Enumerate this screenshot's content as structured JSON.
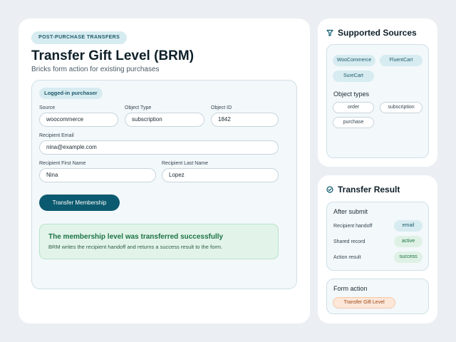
{
  "main": {
    "eyebrow": "POST-PURCHASE TRANSFERS",
    "title": "Transfer Gift Level (BRM)",
    "subtitle": "Bricks form action for existing purchases",
    "form": {
      "badge": "Logged-in purchaser",
      "fields": {
        "source": {
          "label": "Source",
          "value": "woocommerce"
        },
        "object_type": {
          "label": "Object Type",
          "value": "subscription"
        },
        "object_id": {
          "label": "Object ID",
          "value": "1842"
        },
        "recipient_email": {
          "label": "Recipient Email",
          "value": "nina@example.com"
        },
        "first_name": {
          "label": "Recipient First Name",
          "value": "Nina"
        },
        "last_name": {
          "label": "Recipient Last Name",
          "value": "Lopez"
        }
      },
      "submit_label": "Transfer Membership",
      "success": {
        "title": "The membership level was transferred successfully",
        "description": "BRM writes the recipient handoff and returns a success result to the form."
      }
    }
  },
  "supported_sources": {
    "title": "Supported Sources",
    "icon": "funnel-icon",
    "sources": [
      "WooCommerce",
      "FluentCart",
      "SureCart"
    ],
    "object_types_heading": "Object types",
    "object_types": [
      "order",
      "subscription",
      "purchase"
    ]
  },
  "transfer_result": {
    "title": "Transfer Result",
    "icon": "check-circle-icon",
    "after_submit_heading": "After submit",
    "rows": [
      {
        "label": "Recipient handoff",
        "value": "email"
      },
      {
        "label": "Shared record",
        "value": "active"
      },
      {
        "label": "Action result",
        "value": "success"
      }
    ],
    "form_action_heading": "Form action",
    "form_action_value": "Transfer Gift Level"
  },
  "colors": {
    "background": "#ebeff3",
    "primary": "#0c5a6f",
    "accent_teal": "#d7ecf1",
    "success_green": "#1c7344",
    "orange_chip": "#fde7d9"
  }
}
